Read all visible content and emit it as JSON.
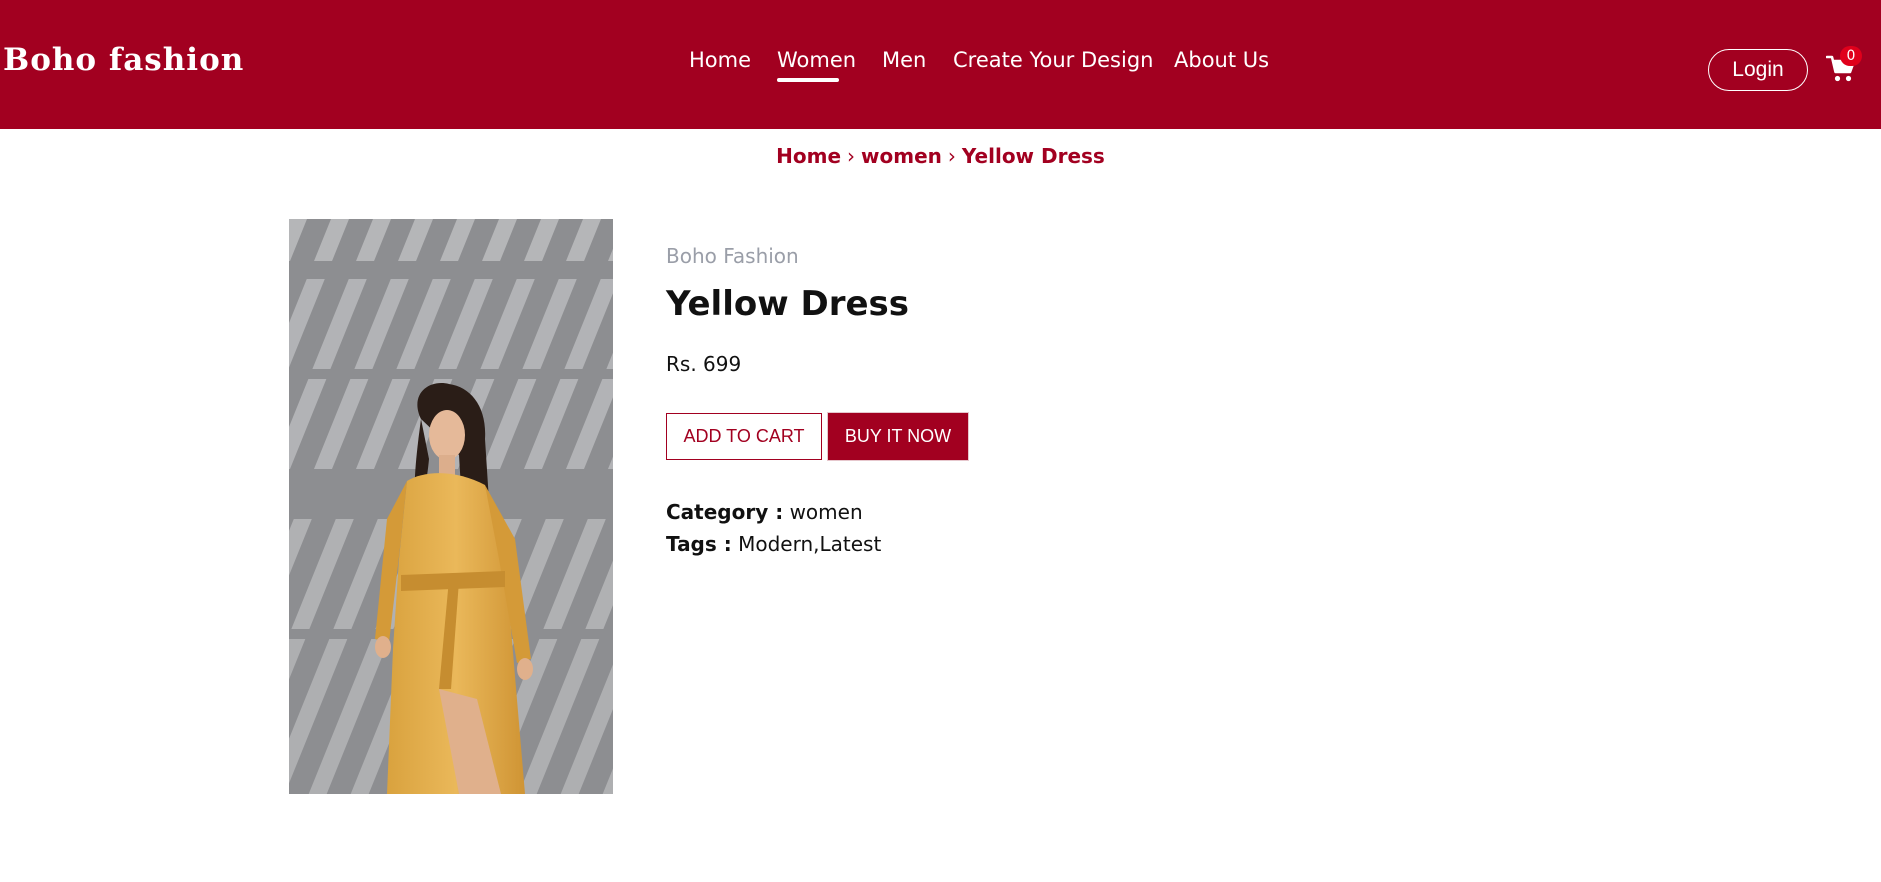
{
  "header": {
    "logo": "Boho fashion",
    "nav": [
      {
        "label": "Home"
      },
      {
        "label": "Women",
        "active": true
      },
      {
        "label": "Men"
      },
      {
        "label": "Create Your Design"
      },
      {
        "label": "About Us"
      }
    ],
    "login_label": "Login",
    "cart_count": "0"
  },
  "breadcrumb": {
    "items": [
      "Home",
      "women",
      "Yellow Dress"
    ],
    "separator": "›"
  },
  "product": {
    "brand": "Boho Fashion",
    "title": "Yellow Dress",
    "price": "Rs. 699",
    "add_to_cart_label": "ADD TO CART",
    "buy_now_label": "BUY IT NOW",
    "category_label": "Category :",
    "category_value": "women",
    "tags_label": "Tags :",
    "tags_value": "Modern,Latest"
  },
  "colors": {
    "brand_red": "#a20020",
    "badge_red": "#e0001b",
    "muted_text": "#9a9ea8"
  },
  "icons": {
    "cart": "shopping-cart-icon"
  }
}
